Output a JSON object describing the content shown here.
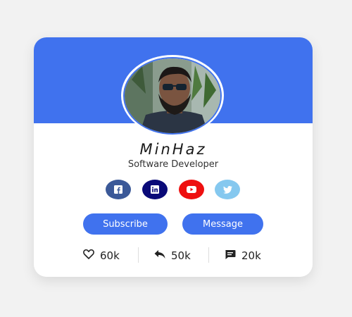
{
  "profile": {
    "name": "MinHaz",
    "role": "Software Developer"
  },
  "social": [
    {
      "icon": "facebook-icon",
      "color": "#3b5998"
    },
    {
      "icon": "linkedin-icon",
      "color": "#0a0a78"
    },
    {
      "icon": "youtube-icon",
      "color": "#ee1010"
    },
    {
      "icon": "twitter-icon",
      "color": "#85c8ef"
    }
  ],
  "actions": {
    "subscribe_label": "Subscribe",
    "message_label": "Message"
  },
  "stats": {
    "likes": "60k",
    "shares": "50k",
    "comments": "20k"
  },
  "colors": {
    "accent": "#4072ee",
    "background": "#f2f2f2"
  }
}
